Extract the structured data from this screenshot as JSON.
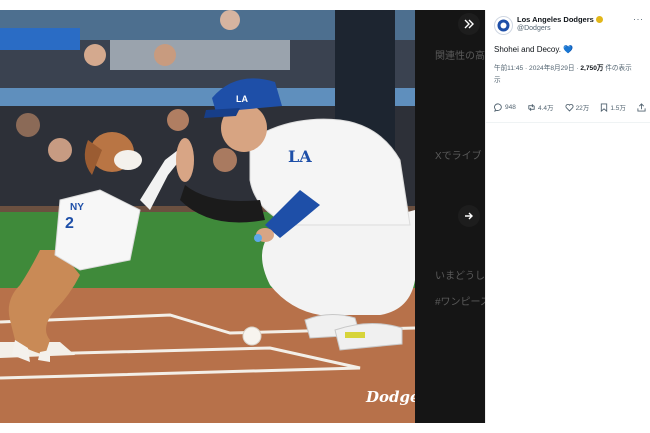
{
  "post": {
    "author_name": "Los Angeles Dodgers",
    "author_handle": "@Dodgers",
    "text": "Shohei and Decoy.",
    "heart": "💙",
    "time": "午前11:45 · 2024年8月29日 · ",
    "views_count": "2,750万",
    "views_label": " 件の表示",
    "views_label_wrap": "示",
    "replies": "948",
    "reposts": "4.4万",
    "likes": "22万",
    "bookmarks": "1.5万"
  },
  "media": {
    "logo_text": "Dodgers",
    "cap_letters": "LA",
    "jersey_text": "LA",
    "ghost_texts": [
      "関連性の高い",
      "Xでライブ",
      "いまどうし",
      "#ワンピース"
    ]
  },
  "colors": {
    "dodger_blue": "#1e4fa8",
    "verified_gold": "#e2b719",
    "heart_blue": "#4aa0e6"
  }
}
